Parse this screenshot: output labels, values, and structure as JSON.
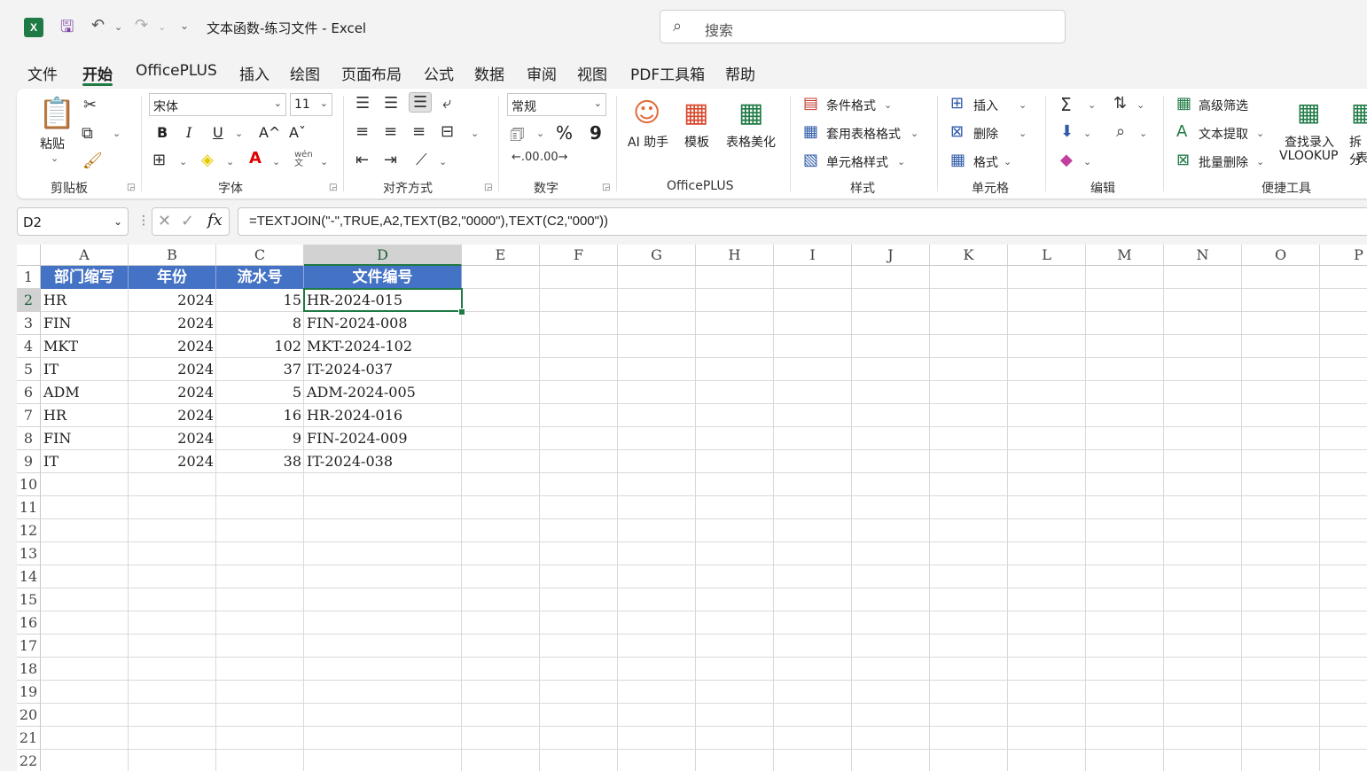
{
  "titlebar": {
    "title": "文本函数-练习文件  -  Excel",
    "search_placeholder": "搜索",
    "app_icon": "X"
  },
  "menu": {
    "items": [
      "文件",
      "开始",
      "OfficePLUS",
      "插入",
      "绘图",
      "页面布局",
      "公式",
      "数据",
      "审阅",
      "视图",
      "PDF工具箱",
      "帮助"
    ],
    "active": "开始"
  },
  "ribbon": {
    "clipboard": {
      "paste": "粘贴",
      "label": "剪贴板"
    },
    "font": {
      "name": "宋体",
      "size": "11",
      "label": "字体",
      "bold": "B",
      "italic": "I",
      "underline": "U",
      "grow": "A^",
      "shrink": "Aˇ",
      "phonetic": "wén 文"
    },
    "alignment": {
      "label": "对齐方式"
    },
    "number": {
      "format": "常规",
      "label": "数字",
      "percent": "%",
      "comma": "9"
    },
    "officeplus": {
      "ai": "AI 助手",
      "template": "模板",
      "beautify": "表格美化",
      "label": "OfficePLUS"
    },
    "styles": {
      "conditional": "条件格式",
      "table": "套用表格格式",
      "cell": "单元格样式",
      "label": "样式"
    },
    "cells": {
      "insert": "插入",
      "delete": "删除",
      "format": "格式",
      "label": "单元格"
    },
    "editing": {
      "label": "编辑"
    },
    "tools": {
      "advanced_filter": "高级筛选",
      "text_extract": "文本提取",
      "batch_delete": "批量删除",
      "vlookup_line1": "查找录入",
      "vlookup_line2": "VLOOKUP",
      "split_line1": "拆分",
      "split_line2": "表",
      "label": "便捷工具"
    }
  },
  "formula_bar": {
    "name_box": "D2",
    "formula": "=TEXTJOIN(\"-\",TRUE,A2,TEXT(B2,\"0000\"),TEXT(C2,\"000\"))"
  },
  "sheet": {
    "columns": [
      "A",
      "B",
      "C",
      "D",
      "E",
      "F",
      "G",
      "H",
      "I",
      "J",
      "K",
      "L",
      "M",
      "N",
      "O",
      "P"
    ],
    "row_numbers": [
      "1",
      "2",
      "3",
      "4",
      "5",
      "6",
      "7",
      "8",
      "9",
      "10",
      "11",
      "12",
      "13",
      "14",
      "15",
      "16",
      "17",
      "18",
      "19",
      "20",
      "21",
      "22"
    ],
    "headers": [
      "部门缩写",
      "年份",
      "流水号",
      "文件编号"
    ],
    "rows": [
      [
        "HR",
        "2024",
        "15",
        "HR-2024-015"
      ],
      [
        "FIN",
        "2024",
        "8",
        "FIN-2024-008"
      ],
      [
        "MKT",
        "2024",
        "102",
        "MKT-2024-102"
      ],
      [
        "IT",
        "2024",
        "37",
        "IT-2024-037"
      ],
      [
        "ADM",
        "2024",
        "5",
        "ADM-2024-005"
      ],
      [
        "HR",
        "2024",
        "16",
        "HR-2024-016"
      ],
      [
        "FIN",
        "2024",
        "9",
        "FIN-2024-009"
      ],
      [
        "IT",
        "2024",
        "38",
        "IT-2024-038"
      ]
    ],
    "selected_cell": "D2",
    "header_fill": "#4472c4",
    "accent": "#1f7a45"
  }
}
